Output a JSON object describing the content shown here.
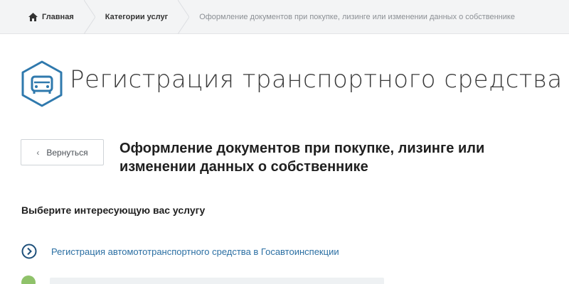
{
  "breadcrumb": {
    "home": "Главная",
    "category": "Категории услуг",
    "current": "Оформление документов при покупке, лизинге или изменении данных о собственнике"
  },
  "page": {
    "title": "Регистрация транспортного средства",
    "icon": "car-icon"
  },
  "back_button": {
    "label": "Вернуться"
  },
  "section_title": "Оформление документов при покупке, лизинге или изменении данных о собственнике",
  "choose_label": "Выберите интересующую вас услугу",
  "services": [
    {
      "label": "Регистрация автомототранспортного средства в Госавтоинспекции"
    }
  ],
  "colors": {
    "accent": "#2b6fa3",
    "icon_stroke": "#2f79ad",
    "breadcrumb_bg": "#f3f4f5",
    "muted_text": "#8b8f94"
  }
}
